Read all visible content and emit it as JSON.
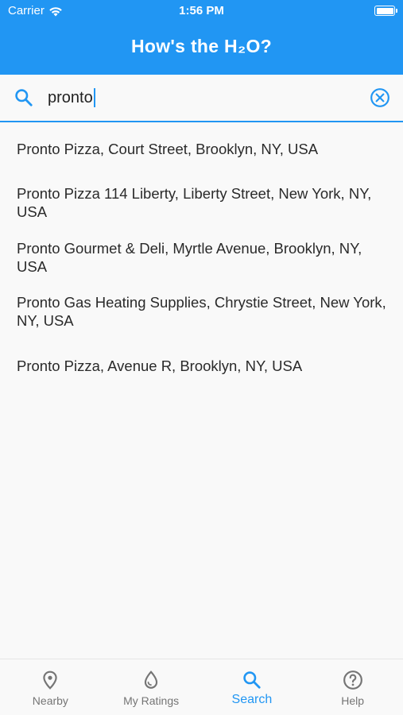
{
  "status_bar": {
    "carrier": "Carrier",
    "time": "1:56 PM"
  },
  "header": {
    "title": "How's the H₂O?"
  },
  "search": {
    "query": "pronto"
  },
  "results": [
    "Pronto Pizza, Court Street, Brooklyn, NY, USA",
    "Pronto Pizza 114 Liberty, Liberty Street, New York, NY, USA",
    "Pronto Gourmet & Deli, Myrtle Avenue, Brooklyn, NY, USA",
    "Pronto Gas Heating Supplies, Chrystie Street, New York, NY, USA",
    "Pronto Pizza, Avenue R, Brooklyn, NY, USA"
  ],
  "tabs": [
    {
      "label": "Nearby",
      "icon": "location-pin-icon",
      "active": false
    },
    {
      "label": "My Ratings",
      "icon": "water-drop-icon",
      "active": false
    },
    {
      "label": "Search",
      "icon": "search-icon",
      "active": true
    },
    {
      "label": "Help",
      "icon": "help-circle-icon",
      "active": false
    }
  ],
  "colors": {
    "accent": "#2196f3",
    "inactive": "#757575",
    "background": "#f9f9f9"
  }
}
